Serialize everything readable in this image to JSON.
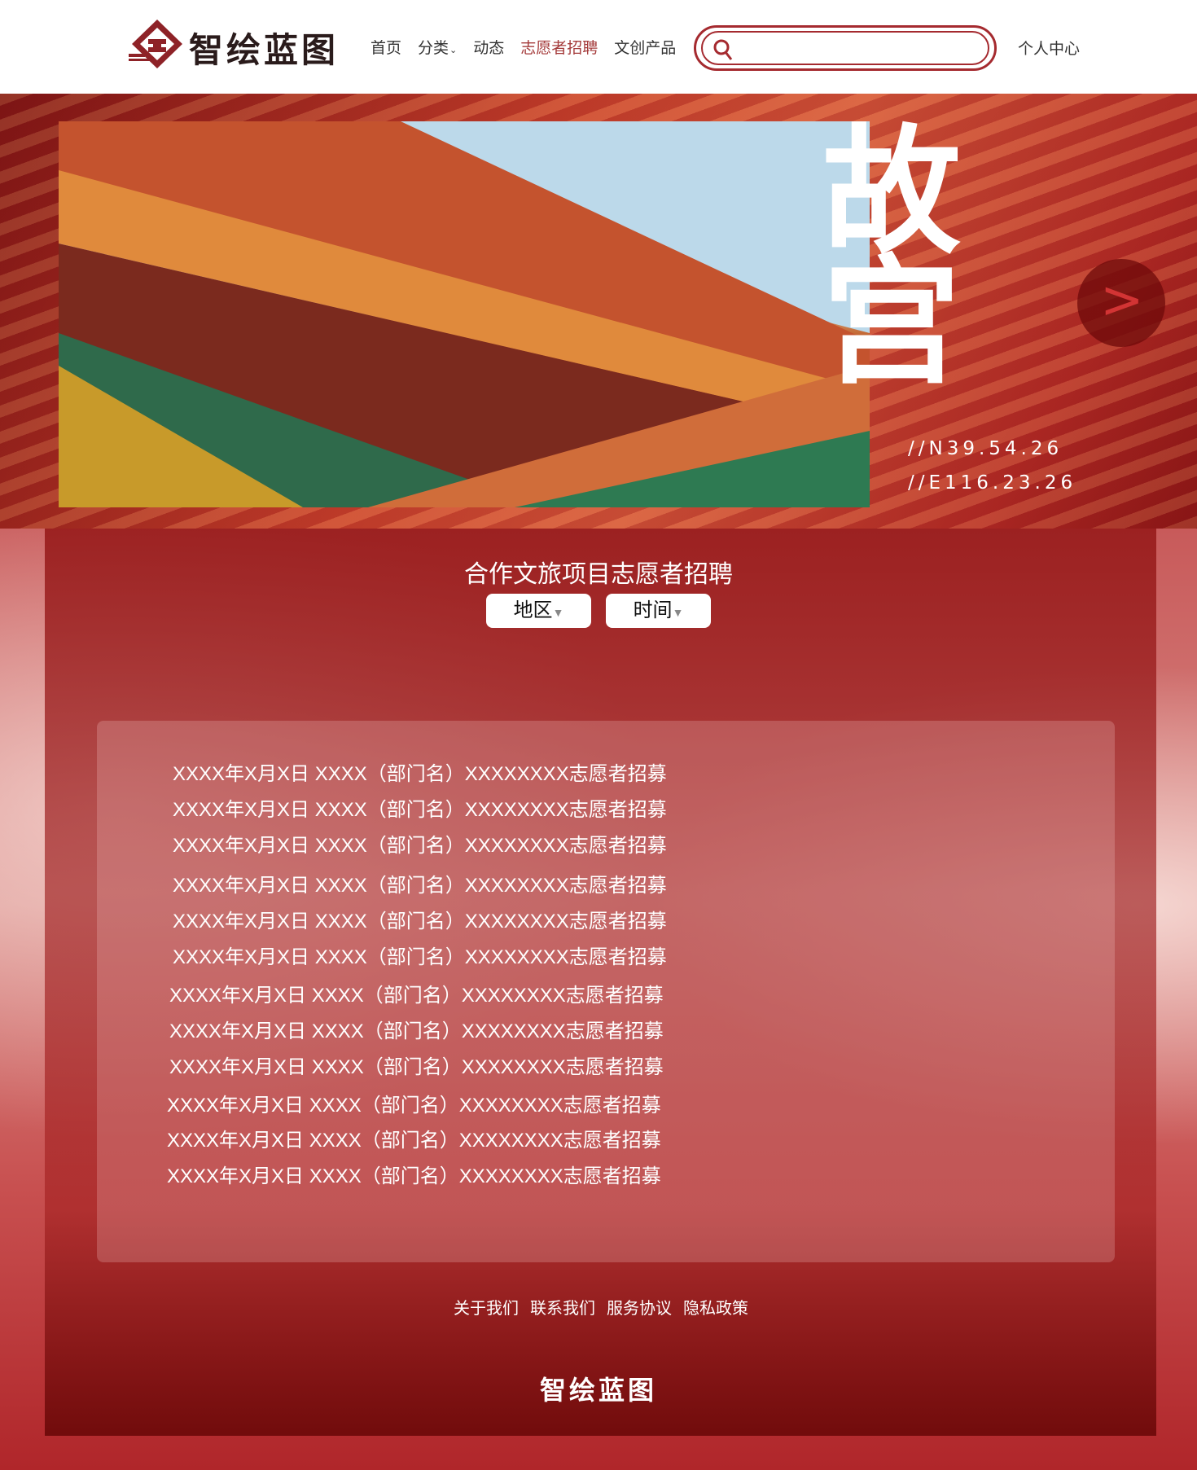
{
  "brand": {
    "name": "智绘蓝图",
    "accent": "#a52a2f"
  },
  "nav": {
    "items": [
      {
        "label": "首页"
      },
      {
        "label": "分类"
      },
      {
        "label": "动态"
      },
      {
        "label": "志愿者招聘",
        "active": true
      },
      {
        "label": "文创产品"
      }
    ]
  },
  "search": {
    "placeholder": "",
    "value": ""
  },
  "user_center": "个人中心",
  "banner": {
    "title": "故宫",
    "coord_n": "//N39.54.26",
    "coord_e": "//E116.23.26",
    "next_icon": "chevron-right-icon"
  },
  "section": {
    "title": "合作文旅项目志愿者招聘",
    "filters": [
      {
        "label": "地区"
      },
      {
        "label": "时间"
      }
    ]
  },
  "recruitments": [
    "XXXX年X月X日 XXXX（部门名）XXXXXXXX志愿者招募",
    "XXXX年X月X日 XXXX（部门名）XXXXXXXX志愿者招募",
    "XXXX年X月X日 XXXX（部门名）XXXXXXXX志愿者招募",
    "XXXX年X月X日 XXXX（部门名）XXXXXXXX志愿者招募",
    "XXXX年X月X日 XXXX（部门名）XXXXXXXX志愿者招募",
    "XXXX年X月X日 XXXX（部门名）XXXXXXXX志愿者招募",
    "XXXX年X月X日 XXXX（部门名）XXXXXXXX志愿者招募",
    "XXXX年X月X日 XXXX（部门名）XXXXXXXX志愿者招募",
    "XXXX年X月X日 XXXX（部门名）XXXXXXXX志愿者招募",
    "XXXX年X月X日 XXXX（部门名）XXXXXXXX志愿者招募",
    "XXXX年X月X日 XXXX（部门名）XXXXXXXX志愿者招募",
    "XXXX年X月X日 XXXX（部门名）XXXXXXXX志愿者招募"
  ],
  "footer": {
    "links": [
      "关于我们",
      "联系我们",
      "服务协议",
      "隐私政策"
    ],
    "brand": "智绘蓝图"
  }
}
